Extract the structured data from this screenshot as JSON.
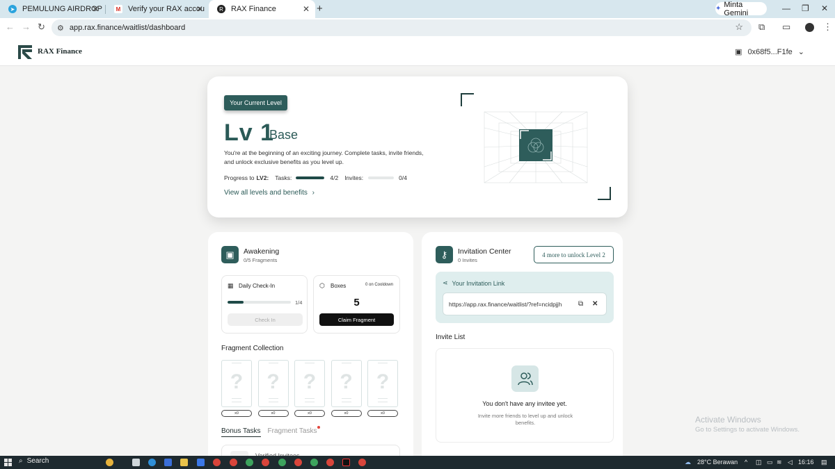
{
  "browser": {
    "tabs": [
      {
        "title": "PEMULUNG AIRDROP",
        "icon": "telegram-icon",
        "active": false
      },
      {
        "title": "Verify your RAX account - daffa",
        "icon": "gmail-icon",
        "active": false
      },
      {
        "title": "RAX Finance",
        "icon": "rax-icon",
        "active": true
      }
    ],
    "gemini_label": "Minta Gemini",
    "url": "app.rax.finance/waitlist/dashboard"
  },
  "header": {
    "brand": "RAX Finance",
    "wallet": "0x68f5...F1fe"
  },
  "level": {
    "badge": "Your Current Level",
    "number": "Lv 1",
    "name": "Base",
    "description": "You're at the beginning of an exciting journey. Complete tasks, invite friends, and unlock exclusive benefits as you level up.",
    "progress_label": "Progress to",
    "progress_target": "LV2:",
    "tasks_label": "Tasks:",
    "tasks_value": "4/2",
    "tasks_fraction": 1.0,
    "invites_label": "Invites:",
    "invites_value": "0/4",
    "invites_fraction": 0.0,
    "view_all": "View all levels and benefits"
  },
  "awakening": {
    "title": "Awakening",
    "subtitle": "0/5 Fragments",
    "checkin": {
      "title": "Daily Check-In",
      "progress": "1/4",
      "progress_fraction": 0.25,
      "button": "Check In"
    },
    "boxes": {
      "title": "Boxes",
      "cooldown": "0 on Cooldown",
      "count": "5",
      "button": "Claim Fragment"
    },
    "collection_title": "Fragment Collection",
    "fragments": [
      {
        "symbol": "?",
        "count": "x0"
      },
      {
        "symbol": "?",
        "count": "x0"
      },
      {
        "symbol": "?",
        "count": "x0"
      },
      {
        "symbol": "?",
        "count": "x0"
      },
      {
        "symbol": "?",
        "count": "x0"
      }
    ],
    "tabs": {
      "bonus": "Bonus Tasks",
      "fragment": "Fragment Tasks"
    },
    "partial_item": "Verified Invitees"
  },
  "invitation": {
    "title": "Invitation Center",
    "subtitle": "0 Invites",
    "unlock_button": "4 more to unlock Level 2",
    "link_label": "Your Invitation Link",
    "link": "https://app.rax.finance/waitlist/?ref=ncidpjjh",
    "list_title": "Invite List",
    "empty_title": "You don't have any invitee yet.",
    "empty_sub": "Invite more friends to level up and unlock benefits."
  },
  "watermark": {
    "line1": "Activate Windows",
    "line2": "Go to Settings to activate Windows."
  },
  "taskbar": {
    "search": "Search",
    "weather": "28°C Berawan",
    "time": "16:16"
  },
  "colors": {
    "accent": "#2e5d5b",
    "page_bg": "#f4f4f3",
    "tab_strip": "#d7e7ee",
    "notification": "#e2443c"
  }
}
